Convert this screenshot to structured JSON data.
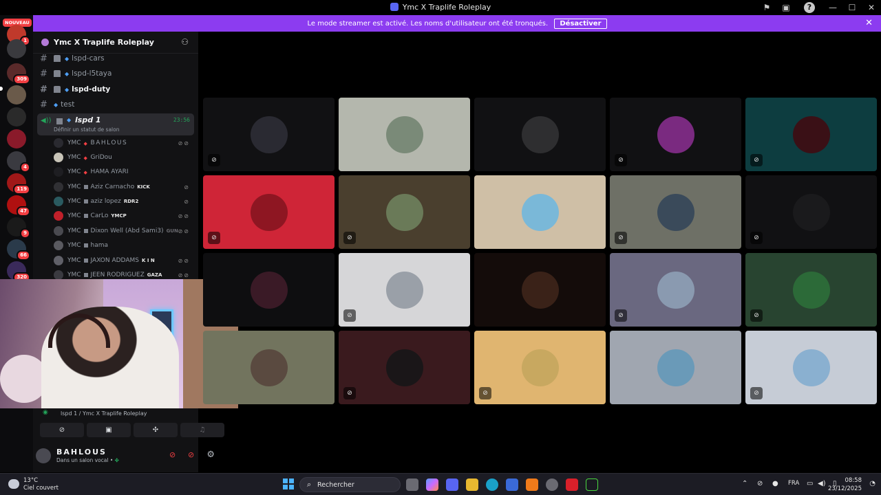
{
  "window": {
    "title": "Ymc X Traplife Roleplay"
  },
  "banner": {
    "message": "Le mode streamer est activé. Les noms d'utilisateur ont été tronqués.",
    "button": "Désactiver"
  },
  "rail": {
    "new_label": "NOUVEAU",
    "badges": [
      "1",
      "309",
      "4",
      "119",
      "47",
      "9",
      "66",
      "320"
    ]
  },
  "server": {
    "name": "Ymc X Traplife Roleplay"
  },
  "channels": [
    {
      "name": "lspd-cars"
    },
    {
      "name": "lspd-l5taya"
    },
    {
      "name": "lspd-duty"
    },
    {
      "name": "test"
    }
  ],
  "voice_channel": {
    "name": "lspd 1",
    "timer": "23:56",
    "status": "Définir un statut de salon"
  },
  "voice_users": [
    {
      "tag": "YMC",
      "name": "BAHLOUS",
      "badge": ""
    },
    {
      "tag": "YMC",
      "name": "GriDou",
      "badge": ""
    },
    {
      "tag": "YMC",
      "name": "HAMA AYARI",
      "badge": ""
    },
    {
      "tag": "YMC",
      "name": "Aziz Carnacho",
      "badge": "KICK"
    },
    {
      "tag": "YMC",
      "name": "aziz lopez",
      "badge": "RDR2"
    },
    {
      "tag": "YMC",
      "name": "CarLo",
      "badge": "YMCP"
    },
    {
      "tag": "YMC",
      "name": "Dixon Well (Abd Sami3)",
      "badge": "GUN"
    },
    {
      "tag": "YMC",
      "name": "hama",
      "badge": ""
    },
    {
      "tag": "YMC",
      "name": "JAXON ADDAMS",
      "badge": "K I N"
    },
    {
      "tag": "YMC",
      "name": "JEEN RODRIGUEZ",
      "badge": "GAZA"
    }
  ],
  "voice_panel": {
    "connection": "lspd 1 / Ymc X Traplife Roleplay"
  },
  "user": {
    "name": "BAHLOUS",
    "status": "Dans un salon vocal •"
  },
  "grid_tiles": [
    {
      "bg": "#111113",
      "avatar": "#2a2a32",
      "muted": true
    },
    {
      "bg": "#b4b7ad",
      "avatar": "#7a8a78",
      "muted": false
    },
    {
      "bg": "#111113",
      "avatar": "#2e2e30",
      "muted": false
    },
    {
      "bg": "#111113",
      "avatar": "#7a2a80",
      "muted": true
    },
    {
      "bg": "#0d3d40",
      "avatar": "#3a1016",
      "muted": true
    },
    {
      "bg": "#cf2537",
      "avatar": "#8e1622",
      "muted": true
    },
    {
      "bg": "#4a3f2e",
      "avatar": "#6a7a58",
      "muted": true
    },
    {
      "bg": "#cfbfa6",
      "avatar": "#7ab8d8",
      "muted": false
    },
    {
      "bg": "#6e7066",
      "avatar": "#3a4a5a",
      "muted": true
    },
    {
      "bg": "#111113",
      "avatar": "#1a1a1c",
      "muted": true
    },
    {
      "bg": "#0e0e10",
      "avatar": "#3a1a26",
      "muted": false
    },
    {
      "bg": "#d6d6d8",
      "avatar": "#9aa0a8",
      "muted": true
    },
    {
      "bg": "#140c0a",
      "avatar": "#3a2218",
      "muted": false
    },
    {
      "bg": "#6a6880",
      "avatar": "#8a9ab0",
      "muted": true
    },
    {
      "bg": "#284430",
      "avatar": "#2c6a38",
      "muted": true
    },
    {
      "bg": "#72745e",
      "avatar": "#5a4a40",
      "muted": false
    },
    {
      "bg": "#3a1a1e",
      "avatar": "#1a1618",
      "muted": true
    },
    {
      "bg": "#e0b570",
      "avatar": "#c8a860",
      "muted": true
    },
    {
      "bg": "#a0a6b0",
      "avatar": "#6a9ab8",
      "muted": false
    },
    {
      "bg": "#c6ccd6",
      "avatar": "#8ab0d0",
      "muted": true
    }
  ],
  "taskbar": {
    "temp": "13°C",
    "weather": "Ciel couvert",
    "search_placeholder": "Rechercher",
    "lang": "FRA",
    "time": "08:58",
    "date": "23/12/2025"
  }
}
